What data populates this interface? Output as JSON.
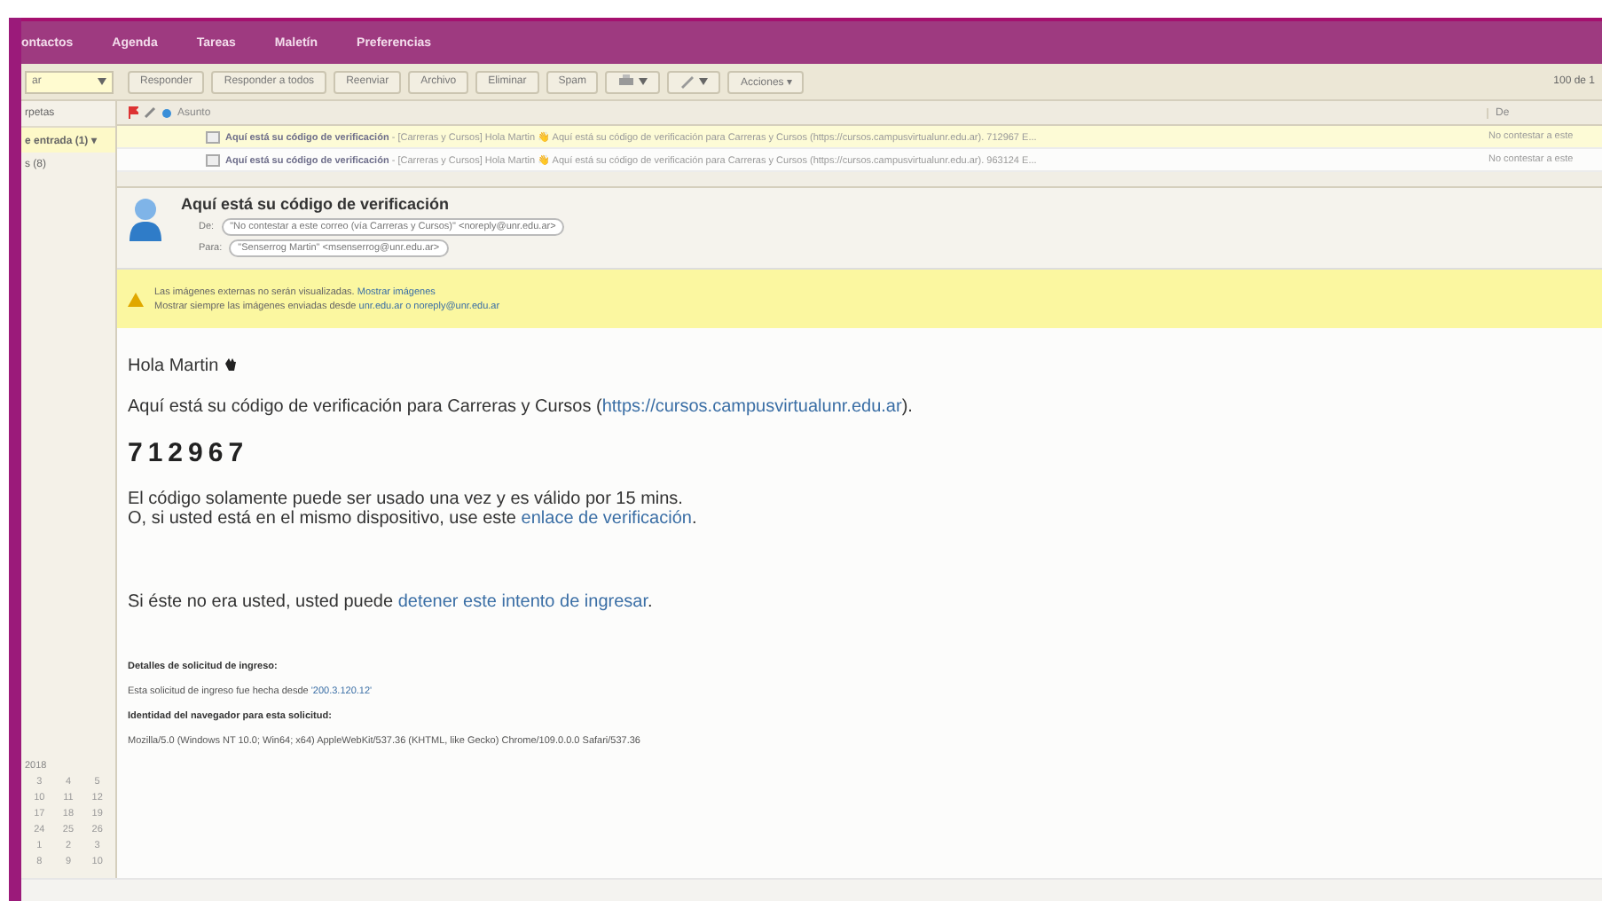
{
  "nav": {
    "tabs": [
      "ontactos",
      "Agenda",
      "Tareas",
      "Maletín",
      "Preferencias"
    ]
  },
  "toolbar": {
    "buttons": [
      {
        "kind": "text",
        "label": "Responder"
      },
      {
        "kind": "text",
        "label": "Responder a todos"
      },
      {
        "kind": "text",
        "label": "Reenviar"
      },
      {
        "kind": "text",
        "label": "Archivo"
      },
      {
        "kind": "text",
        "label": "Eliminar"
      },
      {
        "kind": "text",
        "label": "Spam"
      },
      {
        "kind": "print"
      },
      {
        "kind": "tag"
      },
      {
        "kind": "text",
        "label": "Acciones ▾"
      }
    ],
    "count": "100 de 1"
  },
  "sidebar": {
    "dropdown": "ar",
    "header": "rpetas",
    "items": [
      {
        "label": "e entrada (1) ▾",
        "selected": true
      },
      {
        "label": "s (8)",
        "selected": false
      }
    ]
  },
  "calendar": {
    "header": "2018",
    "rows": [
      [
        "3",
        "4",
        "5"
      ],
      [
        "10",
        "11",
        "12"
      ],
      [
        "17",
        "18",
        "19"
      ],
      [
        "24",
        "25",
        "26"
      ],
      [
        "1",
        "2",
        "3"
      ],
      [
        "8",
        "9",
        "10"
      ]
    ]
  },
  "message_list": {
    "columns": [
      "Asunto",
      "De"
    ],
    "rows": [
      {
        "subject": "Aquí está su código de verificación",
        "fragment": " - [Carreras y Cursos] Hola Martin 👋 Aquí está su código de verificación para Carreras y Cursos (https://cursos.campusvirtualunr.edu.ar). 712967 E...",
        "from": "No contestar a este",
        "selected": true
      },
      {
        "subject": "Aquí está su código de verificación",
        "fragment": " - [Carreras y Cursos] Hola Martin 👋 Aquí está su código de verificación para Carreras y Cursos (https://cursos.campusvirtualunr.edu.ar). 963124 E...",
        "from": "No contestar a este",
        "selected": false
      }
    ]
  },
  "message": {
    "subject": "Aquí está su código de verificación",
    "from_label": "De:",
    "from": "\"No contestar a este correo (vía Carreras y Cursos)\" <noreply@unr.edu.ar>",
    "to_label": "Para:",
    "to": "\"Senserrog Martin\" <msenserrog@unr.edu.ar>"
  },
  "warning": {
    "text": "Las imágenes externas no serán visualizadas.",
    "link": "Mostrar imágenes",
    "text2": "Mostrar siempre las imágenes enviadas desde",
    "link2": "unr.edu.ar o noreply@unr.edu.ar"
  },
  "body": {
    "greeting": "Hola Martin",
    "intro": "Aquí está su código de verificación para Carreras y Cursos (",
    "intro_link": "https://cursos.campusvirtualunr.edu.ar",
    "intro_end": ").",
    "code": "712967",
    "line1": "El código solamente puede ser usado una vez y es válido por 15 mins.",
    "line2": "O, si usted está en el mismo dispositivo, use este ",
    "line2_link": "enlace de verificación",
    "line2_end": ".",
    "line3": "Si éste no era usted, usted puede ",
    "line3_link": "detener este intento de ingresar",
    "line3_end": ".",
    "details_title": "Detalles de solicitud de ingreso:",
    "details_text": "Esta solicitud de ingreso fue hecha desde ",
    "details_ip": "'200.3.120.12'",
    "browser_title": "Identidad del navegador para esta solicitud:",
    "browser": "Mozilla/5.0 (Windows NT 10.0; Win64; x64) AppleWebKit/537.36 (KHTML, like Gecko) Chrome/109.0.0.0 Safari/537.36"
  }
}
